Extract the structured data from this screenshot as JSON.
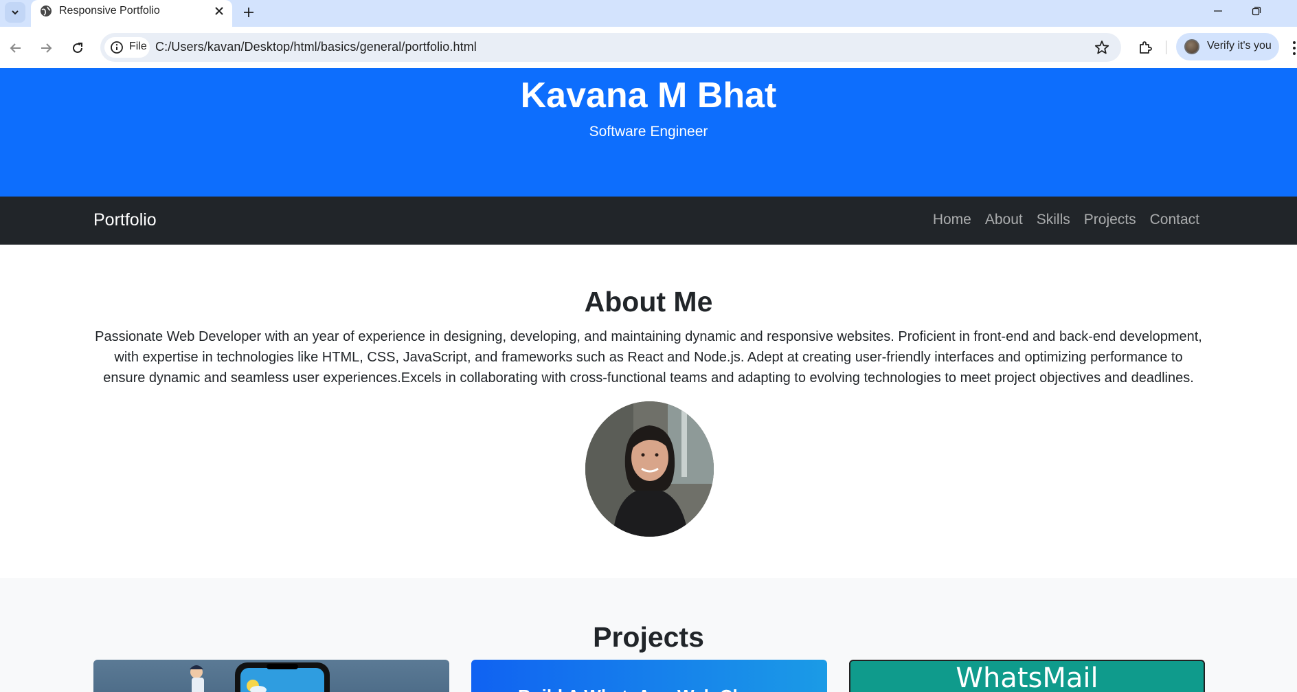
{
  "browser": {
    "tab_title": "Responsive Portfolio",
    "chip_label": "File",
    "url": "C:/Users/kavan/Desktop/html/basics/general/portfolio.html",
    "profile_label": "Verify it's you",
    "icons": [
      "tab-list-icon",
      "globe-icon",
      "close-icon",
      "plus-icon",
      "minimize-icon",
      "restore-icon",
      "back-icon",
      "forward-icon",
      "reload-icon",
      "info-icon",
      "star-icon",
      "extensions-icon",
      "more-icon"
    ]
  },
  "hero": {
    "name": "Kavana M Bhat",
    "role": "Software Engineer",
    "background_color": "#0d6efd"
  },
  "navbar": {
    "brand": "Portfolio",
    "links": [
      "Home",
      "About",
      "Skills",
      "Projects",
      "Contact"
    ],
    "background_color": "#212529"
  },
  "about": {
    "title": "About Me",
    "text": "Passionate Web Developer with an year of experience in designing, developing, and maintaining dynamic and responsive websites. Proficient in front-end and back-end development, with expertise in technologies like HTML, CSS, JavaScript, and frameworks such as React and Node.js. Adept at creating user-friendly interfaces and optimizing performance to ensure dynamic and seamless user experiences.Excels in collaborating with cross-functional teams and adapting to evolving technologies to meet project objectives and deadlines."
  },
  "projects": {
    "title": "Projects",
    "cards": [
      {
        "image_text": ""
      },
      {
        "image_text": "Build A WhatsApp Web Cl"
      },
      {
        "image_text": "WhatsMail"
      }
    ]
  }
}
